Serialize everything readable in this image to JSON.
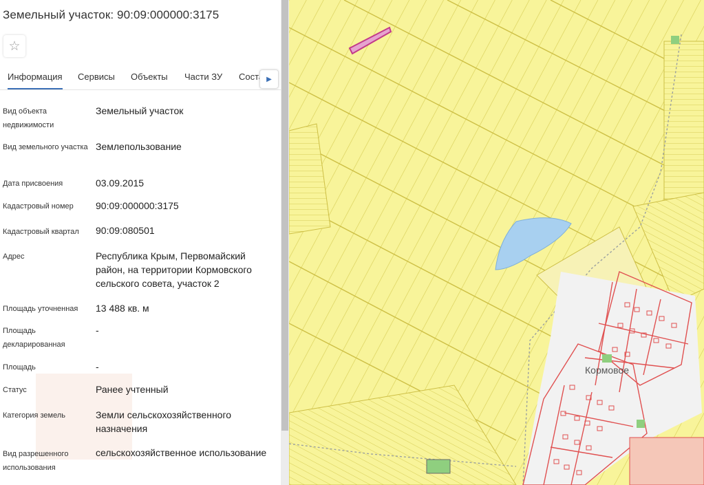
{
  "panel": {
    "title": "Земельный участок: 90:09:000000:3175",
    "favorite_icon": "star-icon",
    "tabs": [
      {
        "label": "Информация",
        "active": true
      },
      {
        "label": "Сервисы",
        "active": false
      },
      {
        "label": "Объекты",
        "active": false
      },
      {
        "label": "Части ЗУ",
        "active": false
      },
      {
        "label": "Состав",
        "active": false
      }
    ],
    "tabs_next_icon": "chevron-right-icon",
    "fields": [
      {
        "label": "Вид объекта недвижимости",
        "value": "Земельный участок"
      },
      {
        "label": "Вид земельного участка",
        "value": "Землепользование"
      },
      {
        "label": "Дата присвоения",
        "value": "03.09.2015"
      },
      {
        "label": "Кадастровый номер",
        "value": "90:09:000000:3175"
      },
      {
        "label": "Кадастровый квартал",
        "value": "90:09:080501"
      },
      {
        "label": "Адрес",
        "value": "Республика Крым, Первомайский район, на территории Кормовского сельского совета, участок 2"
      },
      {
        "label": "Площадь уточненная",
        "value": "13 488 кв. м"
      },
      {
        "label": "Площадь декларированная",
        "value": "-"
      },
      {
        "label": "Площадь",
        "value": "-"
      },
      {
        "label": "Статус",
        "value": "Ранее учтенный"
      },
      {
        "label": "Категория земель",
        "value": "Земли сельскохозяйственного назначения"
      },
      {
        "label": "Вид разрешенного использования",
        "value": "сельскохозяйственное использование"
      }
    ]
  },
  "map": {
    "village_label": "Кормовое",
    "colors": {
      "parcel_fill": "#f8f49a",
      "parcel_line": "#d8cf55",
      "building_line": "#e05050",
      "water": "#a8d0f0",
      "selected": "#c23a8a"
    }
  }
}
